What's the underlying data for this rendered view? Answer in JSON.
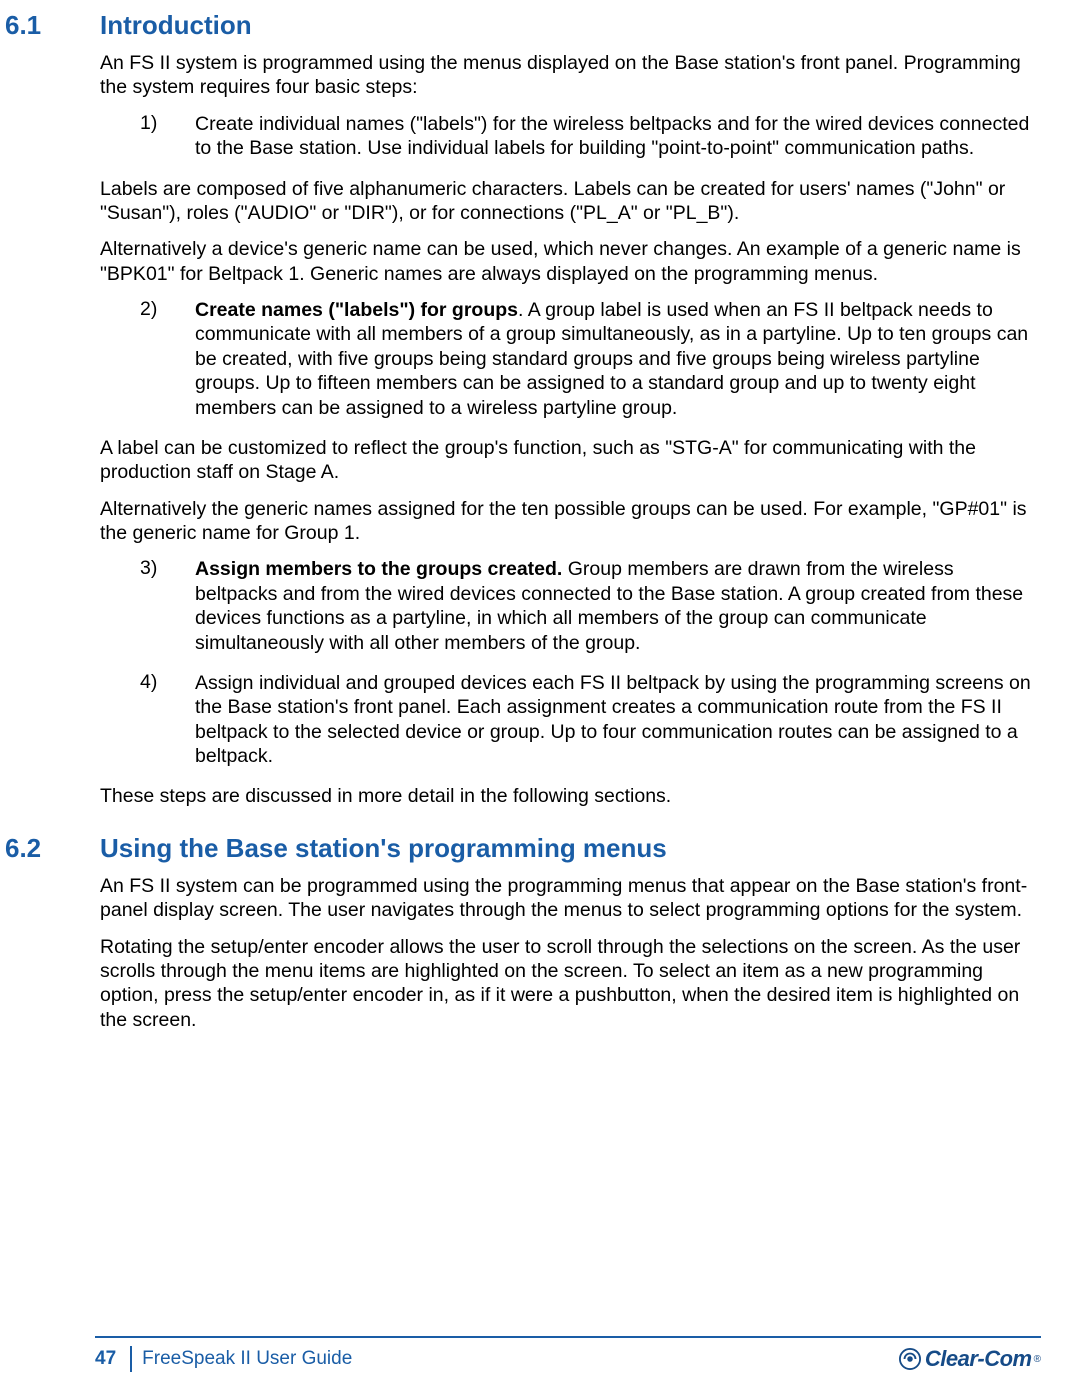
{
  "sections": [
    {
      "num": "6.1",
      "title": "Introduction",
      "blocks": [
        {
          "type": "p",
          "text": "An FS II system is programmed using the menus displayed on the Base station's front panel. Programming the system requires four basic steps:"
        },
        {
          "type": "li",
          "num": "1)",
          "text": "Create individual names (\"labels\") for the wireless beltpacks and for the wired devices connected to the Base station. Use individual labels for building \"point-to-point\" communication paths."
        },
        {
          "type": "p",
          "text": "Labels are composed of five alphanumeric characters. Labels can be created for users' names (\"John\" or \"Susan\"), roles (\"AUDIO\" or \"DIR\"), or for connections (\"PL_A\" or \"PL_B\")."
        },
        {
          "type": "p",
          "text": "Alternatively a device's generic name can be used, which never changes. An example of a generic name is \"BPK01\" for Beltpack 1. Generic names are always displayed on the programming menus."
        },
        {
          "type": "li",
          "num": "2)",
          "bold": "Create names (\"labels\") for groups",
          "text": ". A group label is used when an FS II beltpack needs to communicate with all members of a group simultaneously, as in a partyline. Up to ten groups can be created, with five groups being standard groups and five groups being wireless partyline groups. Up to fifteen members can be assigned to a standard group and up to twenty eight members can be assigned to a wireless partyline group."
        },
        {
          "type": "p",
          "text": "A label can be customized to reflect the group's function, such as \"STG-A\" for communicating with the production staff on Stage A."
        },
        {
          "type": "p",
          "text": "Alternatively the generic names assigned for the ten possible groups can be used. For example, \"GP#01\" is the generic name for Group 1."
        },
        {
          "type": "li",
          "num": "3)",
          "bold": "Assign members to the groups created.",
          "text": " Group members are drawn from the wireless beltpacks and from the wired devices connected to the Base station. A group created from these devices functions as a partyline, in which all members of the group can communicate simultaneously with all other members of the group."
        },
        {
          "type": "li",
          "num": "4)",
          "text": "Assign individual and grouped devices each FS II beltpack by using the programming screens on the Base station's front panel. Each assignment creates a communication route from the FS II beltpack to the selected device or group. Up to four communication routes can be assigned to a beltpack."
        },
        {
          "type": "p",
          "text": "These steps are discussed in more detail in the following sections."
        }
      ]
    },
    {
      "num": "6.2",
      "title": "Using the Base station's programming menus",
      "blocks": [
        {
          "type": "p",
          "text": "An FS II system can be programmed using the programming menus that appear on the Base station's front-panel display screen. The user navigates through the menus to select programming options for the system."
        },
        {
          "type": "p",
          "text": "Rotating the setup/enter encoder allows the user to scroll through the selections on the screen. As the user scrolls through the menu items are highlighted on the screen. To select an item as a new programming option, press the setup/enter encoder in, as if it were a pushbutton, when the desired item is highlighted on the screen."
        }
      ]
    }
  ],
  "footer": {
    "page": "47",
    "guide": "FreeSpeak II User Guide",
    "brand": "Clear-Com"
  }
}
